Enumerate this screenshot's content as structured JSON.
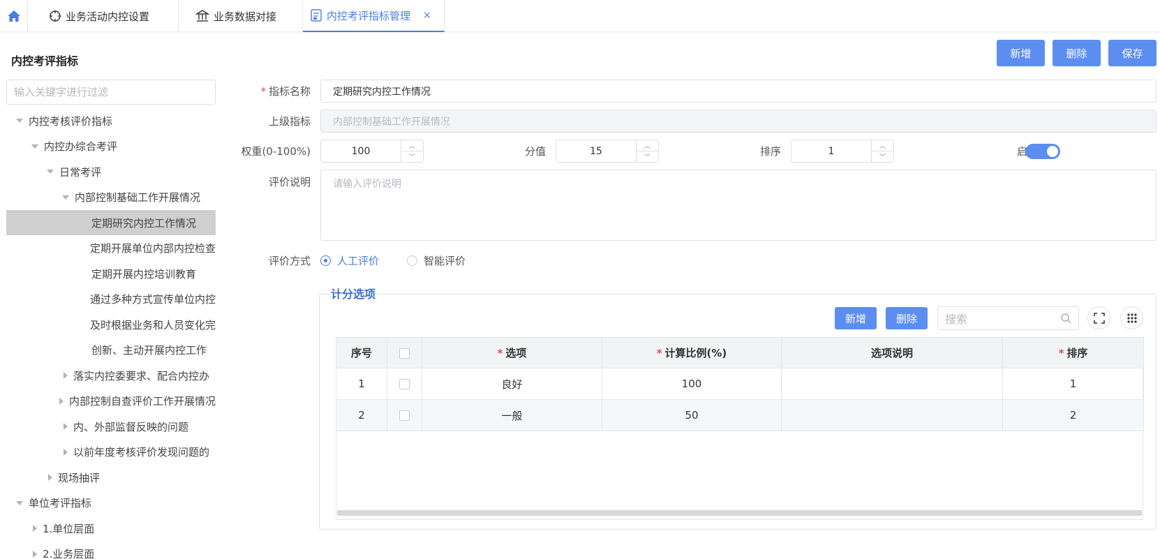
{
  "tabs": {
    "home_icon": "home-icon",
    "items": [
      {
        "label": "业务活动内控设置",
        "icon": "target-icon"
      },
      {
        "label": "业务数据对接",
        "icon": "bank-icon"
      },
      {
        "label": "内控考评指标管理",
        "icon": "report-icon",
        "close": "×"
      }
    ]
  },
  "sidebar": {
    "title": "内控考评指标",
    "filter_placeholder": "输入关键字进行过滤",
    "tree": [
      {
        "label": "内控考核评价指标",
        "level": 0,
        "caret": "down"
      },
      {
        "label": "内控办综合考评",
        "level": 1,
        "caret": "down"
      },
      {
        "label": "日常考评",
        "level": 2,
        "caret": "down"
      },
      {
        "label": "内部控制基础工作开展情况",
        "level": 3,
        "caret": "down"
      },
      {
        "label": "定期研究内控工作情况",
        "level": 4,
        "caret": "none",
        "selected": true
      },
      {
        "label": "定期开展单位内部内控检查",
        "level": 4,
        "caret": "none"
      },
      {
        "label": "定期开展内控培训教育",
        "level": 4,
        "caret": "none"
      },
      {
        "label": "通过多种方式宣传单位内控",
        "level": 4,
        "caret": "none"
      },
      {
        "label": "及时根据业务和人员变化完",
        "level": 4,
        "caret": "none"
      },
      {
        "label": "创新、主动开展内控工作",
        "level": 4,
        "caret": "none"
      },
      {
        "label": "落实内控委要求、配合内控办",
        "level": 3,
        "caret": "right"
      },
      {
        "label": "内部控制自查评价工作开展情况",
        "level": 3,
        "caret": "right"
      },
      {
        "label": "内、外部监督反映的问题",
        "level": 3,
        "caret": "right"
      },
      {
        "label": "以前年度考核评价发现问题的",
        "level": 3,
        "caret": "right"
      },
      {
        "label": "现场抽评",
        "level": 2,
        "caret": "right"
      },
      {
        "label": "单位考评指标",
        "level": 0,
        "caret": "down"
      },
      {
        "label": "1.单位层面",
        "level": 1,
        "caret": "right"
      },
      {
        "label": "2.业务层面",
        "level": 1,
        "caret": "right"
      }
    ]
  },
  "toolbar": {
    "add": "新增",
    "delete": "删除",
    "save": "保存"
  },
  "form": {
    "name_label": "指标名称",
    "name_value": "定期研究内控工作情况",
    "parent_label": "上级指标",
    "parent_value": "内部控制基础工作开展情况",
    "weight_label": "权重(0-100%)",
    "weight_value": "100",
    "score_label": "分值",
    "score_value": "15",
    "order_label": "排序",
    "order_value": "1",
    "enable_label": "启用",
    "enabled": true,
    "desc_label": "评价说明",
    "desc_placeholder": "请输入评价说明",
    "method_label": "评价方式",
    "method_options": [
      "人工评价",
      "智能评价"
    ],
    "method_selected": "人工评价"
  },
  "scoring": {
    "legend": "计分选项",
    "add": "新增",
    "delete": "删除",
    "search_placeholder": "搜索",
    "columns": [
      "序号",
      "选项",
      "计算比例(%)",
      "选项说明",
      "排序"
    ],
    "rows": [
      {
        "no": "1",
        "option": "良好",
        "ratio": "100",
        "desc": "",
        "order": "1"
      },
      {
        "no": "2",
        "option": "一般",
        "ratio": "50",
        "desc": "",
        "order": "2"
      }
    ]
  },
  "colors": {
    "accent": "#5b8ef0",
    "active_tab": "#4a7ee0",
    "required": "#e05050",
    "selected_row": "#cfcfcf"
  }
}
